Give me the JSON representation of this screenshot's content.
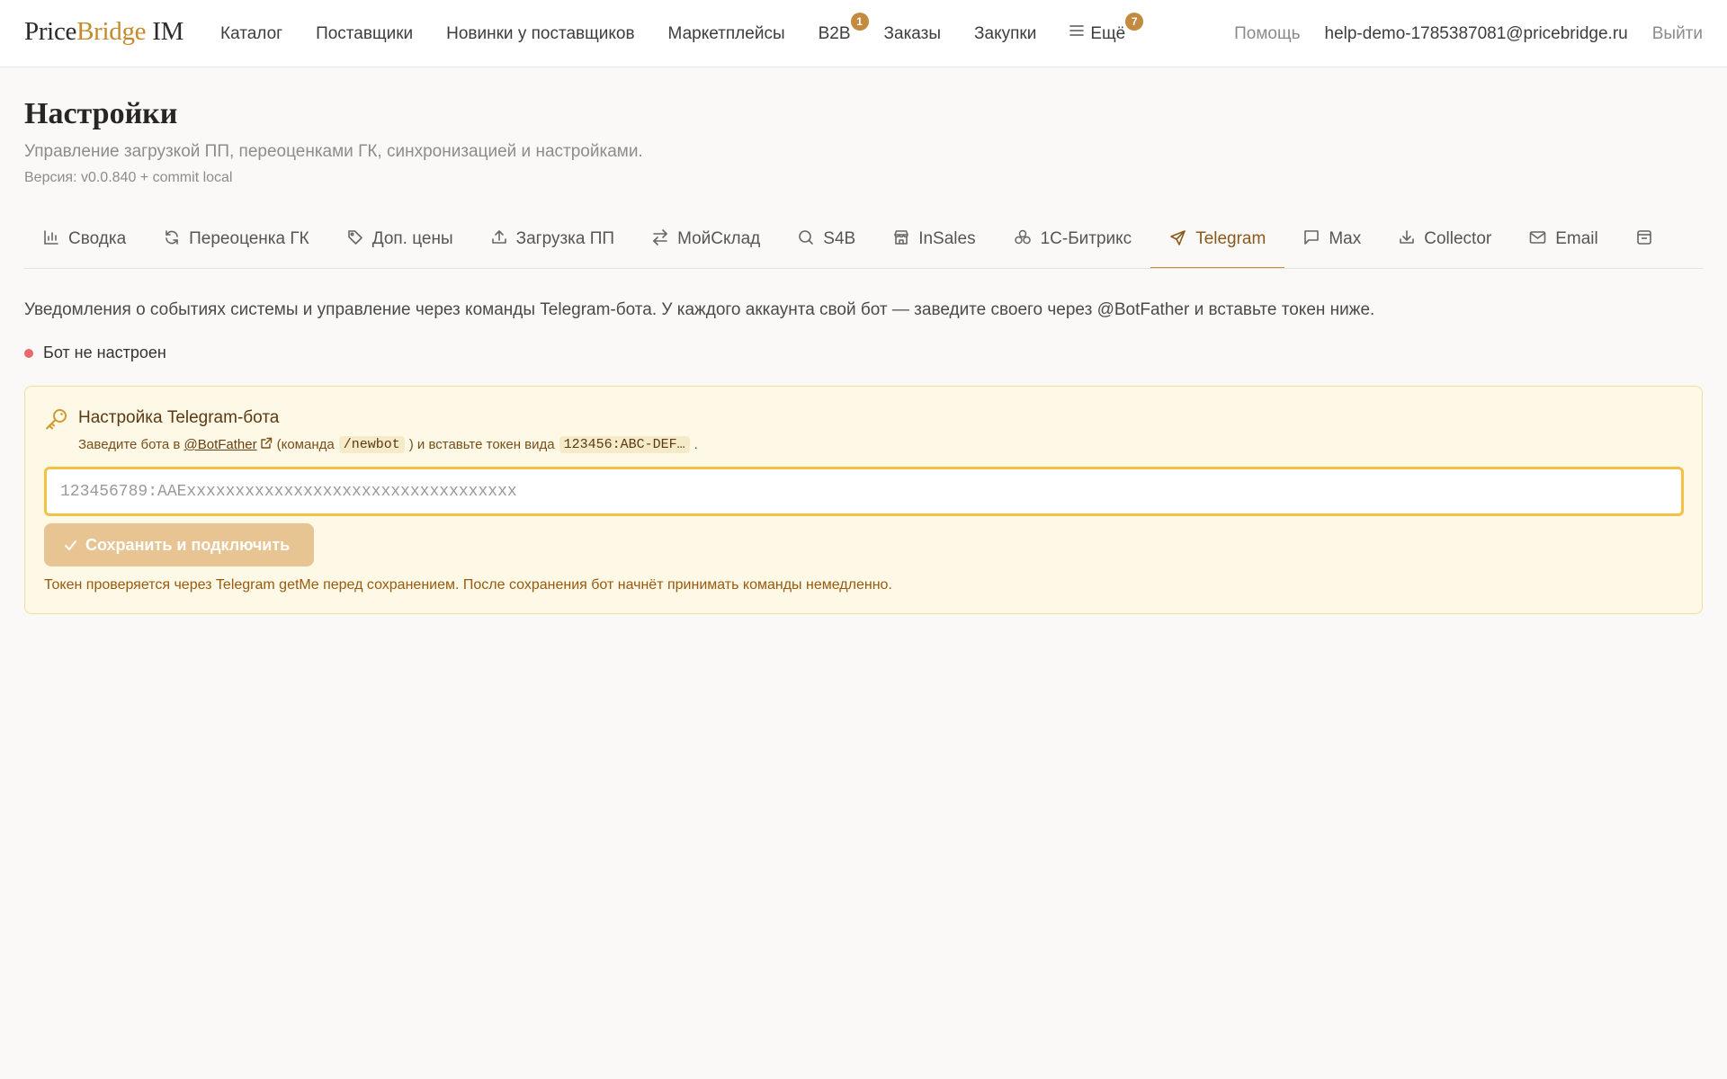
{
  "brand": {
    "part1": "Price",
    "part2": "Bridge",
    "part3": "IM"
  },
  "nav": {
    "items": [
      {
        "label": "Каталог"
      },
      {
        "label": "Поставщики"
      },
      {
        "label": "Новинки у поставщиков"
      },
      {
        "label": "Маркетплейсы"
      },
      {
        "label": "B2B",
        "badge": "1"
      },
      {
        "label": "Заказы"
      },
      {
        "label": "Закупки"
      },
      {
        "label": "Ещё",
        "badge": "7",
        "icon": "menu-icon"
      }
    ],
    "help": "Помощь",
    "user_email": "help-demo-1785387081@pricebridge.ru",
    "logout": "Выйти"
  },
  "page": {
    "title": "Настройки",
    "subtitle": "Управление загрузкой ПП, переоценками ГК, синхронизацией и настройками.",
    "version": "Версия: v0.0.840 + commit local"
  },
  "tabs": [
    {
      "label": "Сводка",
      "icon": "bar-chart-icon"
    },
    {
      "label": "Переоценка ГК",
      "icon": "refresh-icon"
    },
    {
      "label": "Доп. цены",
      "icon": "tag-icon"
    },
    {
      "label": "Загрузка ПП",
      "icon": "upload-icon"
    },
    {
      "label": "МойСклад",
      "icon": "swap-icon"
    },
    {
      "label": "S4B",
      "icon": "search-icon"
    },
    {
      "label": "InSales",
      "icon": "store-icon"
    },
    {
      "label": "1С-Битрикс",
      "icon": "cluster-icon"
    },
    {
      "label": "Telegram",
      "icon": "send-icon",
      "active": true
    },
    {
      "label": "Max",
      "icon": "message-icon"
    },
    {
      "label": "Collector",
      "icon": "download-icon"
    },
    {
      "label": "Email",
      "icon": "mail-icon"
    },
    {
      "label": "",
      "icon": "box-icon"
    }
  ],
  "telegram": {
    "intro": "Уведомления о событиях системы и управление через команды Telegram-бота. У каждого аккаунта свой бот — заведите своего через @BotFather и вставьте токен ниже.",
    "status": {
      "text": "Бот не настроен",
      "color": "#e86a6a"
    },
    "card": {
      "title": "Настройка Telegram-бота",
      "desc_prefix": "Заведите бота в",
      "desc_link": "@BotFather",
      "desc_mid": "(команда",
      "desc_cmd": "/newbot",
      "desc_mid2": ") и вставьте токен вида",
      "desc_token_example": "123456:ABC-DEF…",
      "desc_end": ".",
      "input_placeholder": "123456789:AAExxxxxxxxxxxxxxxxxxxxxxxxxxxxxxxxxx",
      "input_value": "",
      "save_label": "Сохранить и подключить",
      "note": "Токен проверяется через Telegram getMe перед сохранением. После сохранения бот начнёт принимать команды немедленно."
    }
  },
  "colors": {
    "accent": "#c48a3f",
    "card_bg": "#fef8e7",
    "input_border": "#f4c243",
    "button_bg": "#e9c493"
  }
}
